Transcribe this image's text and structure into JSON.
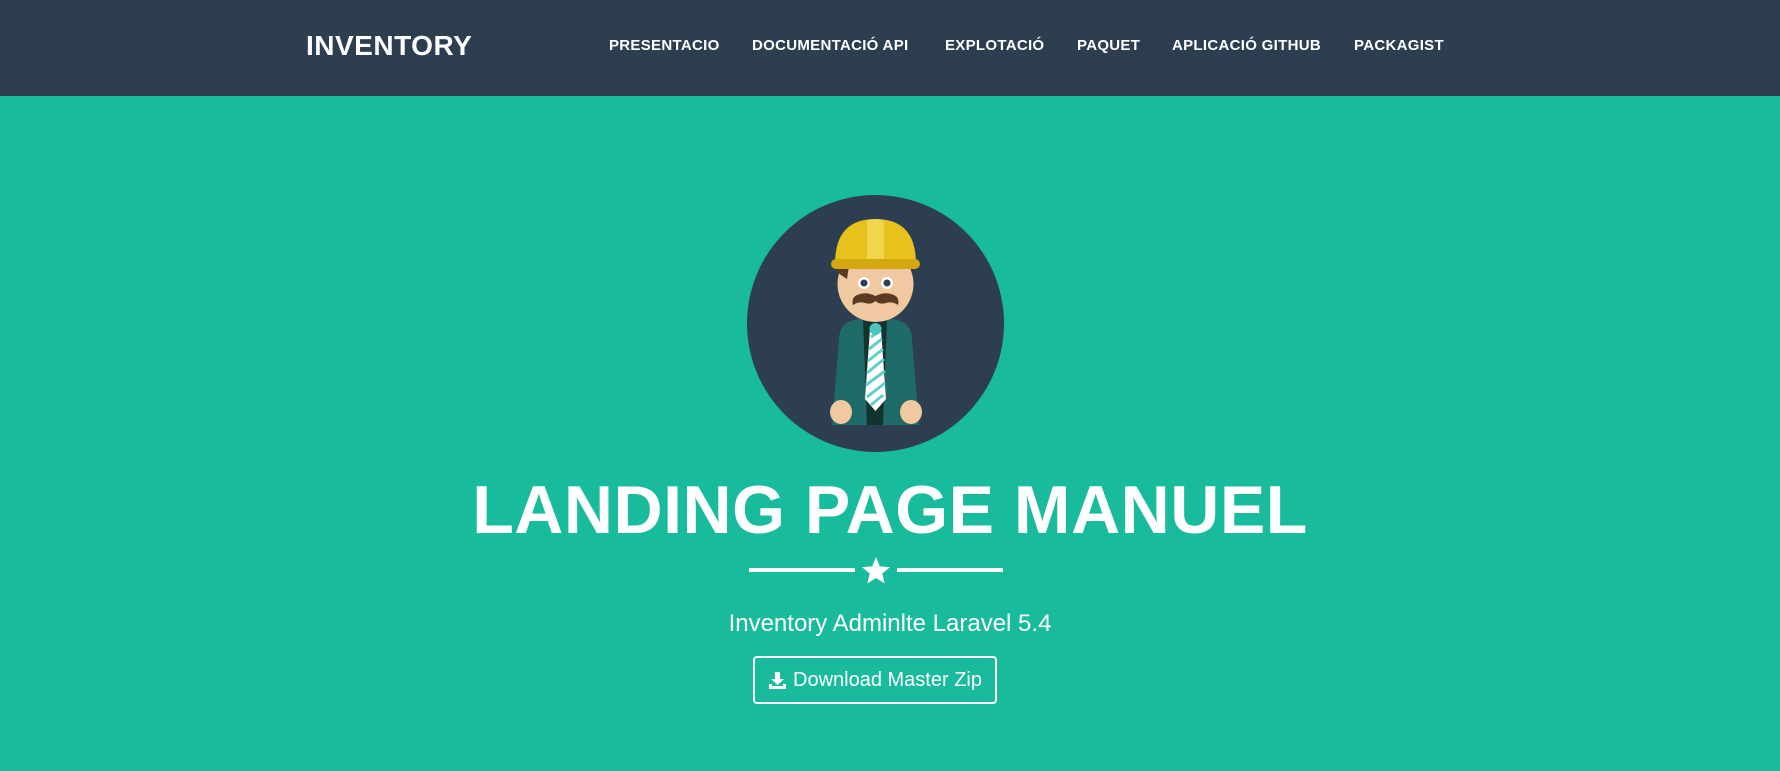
{
  "navbar": {
    "brand": "INVENTORY",
    "links": [
      {
        "label": "PRESENTACIO"
      },
      {
        "label": "DOCUMENTACIÓ API"
      },
      {
        "label": "EXPLOTACIÓ"
      },
      {
        "label": "PAQUET"
      },
      {
        "label": "APLICACIÓ GITHUB"
      },
      {
        "label": "PACKAGIST"
      }
    ]
  },
  "hero": {
    "avatar_icon": "construction-worker-avatar-icon",
    "title": "LANDING PAGE MANUEL",
    "divider_icon": "star-icon",
    "subtitle": "Inventory Adminlte Laravel 5.4",
    "download_button": {
      "icon": "download-icon",
      "label": "Download Master Zip"
    }
  },
  "colors": {
    "navbar_bg": "#2c3e50",
    "hero_bg": "#18bc9c",
    "text": "#ffffff"
  }
}
